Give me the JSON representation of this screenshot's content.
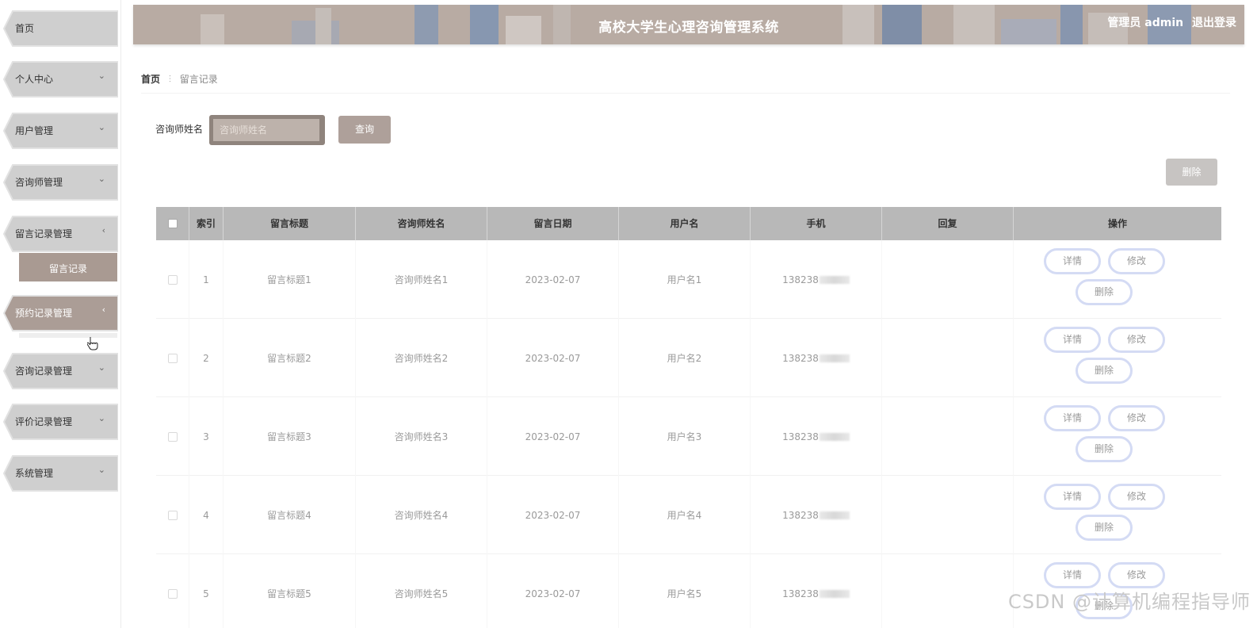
{
  "sidebar": {
    "items": [
      {
        "label": "首页",
        "chevron": ""
      },
      {
        "label": "个人中心",
        "chevron": "⌄"
      },
      {
        "label": "用户管理",
        "chevron": "⌄"
      },
      {
        "label": "咨询师管理",
        "chevron": "⌄"
      },
      {
        "label": "留言记录管理",
        "chevron": "‹"
      },
      {
        "label": "预约记录管理",
        "chevron": "‹"
      },
      {
        "label": "咨询记录管理",
        "chevron": "⌄"
      },
      {
        "label": "评价记录管理",
        "chevron": "⌄"
      },
      {
        "label": "系统管理",
        "chevron": "⌄"
      }
    ],
    "submenu": {
      "label": "留言记录"
    },
    "colors": {
      "inactive": "#cfcfcf",
      "active": "#ab9d96"
    }
  },
  "header": {
    "title": "高校大学生心理咨询管理系统",
    "user": "管理员 admin",
    "logout": "退出登录"
  },
  "breadcrumb": {
    "home": "首页",
    "separator": "⫶",
    "current": "留言记录"
  },
  "search": {
    "label": "咨询师姓名",
    "placeholder": "咨询师姓名",
    "button": "查询"
  },
  "toolbar": {
    "delete": "删除"
  },
  "table": {
    "columns": [
      "",
      "索引",
      "留言标题",
      "咨询师姓名",
      "留言日期",
      "用户名",
      "手机",
      "回复",
      "操作"
    ],
    "rows": [
      {
        "index": "1",
        "title": "留言标题1",
        "counselor": "咨询师姓名1",
        "date": "2023-02-07",
        "username": "用户名1",
        "phone": "138238",
        "reply": ""
      },
      {
        "index": "2",
        "title": "留言标题2",
        "counselor": "咨询师姓名2",
        "date": "2023-02-07",
        "username": "用户名2",
        "phone": "138238",
        "reply": ""
      },
      {
        "index": "3",
        "title": "留言标题3",
        "counselor": "咨询师姓名3",
        "date": "2023-02-07",
        "username": "用户名3",
        "phone": "138238",
        "reply": ""
      },
      {
        "index": "4",
        "title": "留言标题4",
        "counselor": "咨询师姓名4",
        "date": "2023-02-07",
        "username": "用户名4",
        "phone": "138238",
        "reply": ""
      },
      {
        "index": "5",
        "title": "留言标题5",
        "counselor": "咨询师姓名5",
        "date": "2023-02-07",
        "username": "用户名5",
        "phone": "138238",
        "reply": ""
      }
    ],
    "actions": {
      "detail": "详情",
      "edit": "修改",
      "delete": "删除"
    }
  },
  "watermark": "CSDN @计算机编程指导师"
}
